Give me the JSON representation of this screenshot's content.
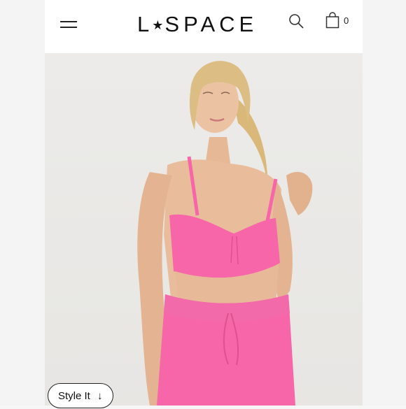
{
  "header": {
    "logo_left": "L",
    "logo_star": "★",
    "logo_right": "SPACE",
    "cart_count": "0"
  },
  "photo": {
    "subject": "model-in-pink-bralette-and-leggings"
  },
  "style_button": {
    "label": "Style It",
    "arrow": "↓"
  },
  "colors": {
    "accent_pink": "#f766a8",
    "background": "#e9e8e5",
    "text": "#111111"
  },
  "icons": [
    "menu-icon",
    "search-icon",
    "shopping-bag-icon",
    "down-arrow-icon"
  ]
}
